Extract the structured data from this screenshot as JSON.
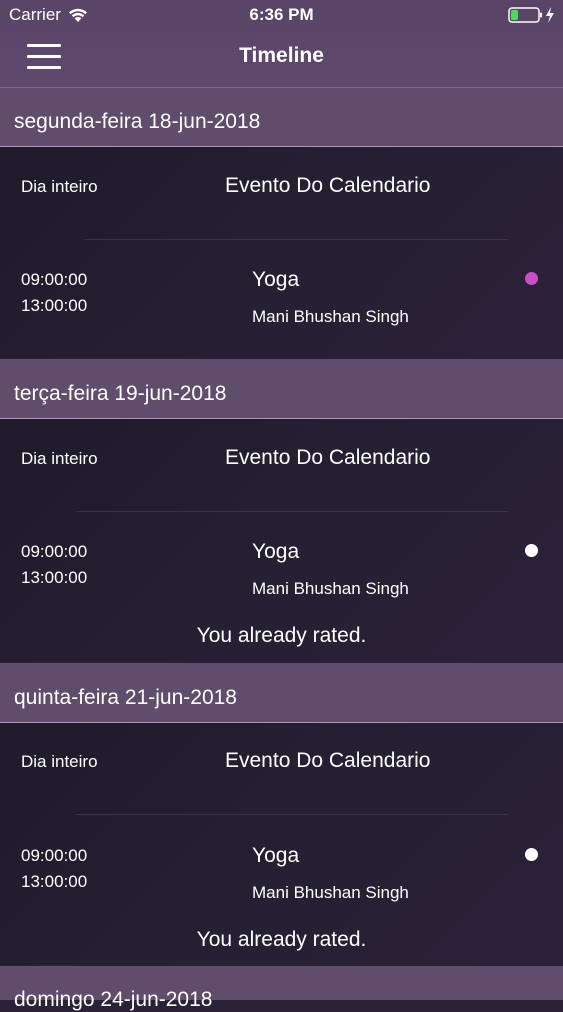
{
  "status_bar": {
    "carrier": "Carrier",
    "time": "6:36 PM"
  },
  "nav": {
    "title": "Timeline"
  },
  "colors": {
    "header_bg": "#5f4d6b",
    "card_bg": "#211d2d",
    "dot_pending": "#c94fc6",
    "dot_rated": "#ffffff"
  },
  "days": [
    {
      "date": "segunda-feira 18-jun-2018",
      "all_day": "Dia inteiro",
      "calendar_event": "Evento Do Calendario",
      "start": "09:00:00",
      "end": "13:00:00",
      "event_title": "Yoga",
      "person": "Mani Bhushan Singh",
      "dot": "pending-dot"
    },
    {
      "date": "terça-feira 19-jun-2018",
      "all_day": "Dia inteiro",
      "calendar_event": "Evento Do Calendario",
      "start": "09:00:00",
      "end": "13:00:00",
      "event_title": "Yoga",
      "person": "Mani Bhushan Singh",
      "dot": "rated-dot",
      "rated_text": "You already rated."
    },
    {
      "date": "quinta-feira 21-jun-2018",
      "all_day": "Dia inteiro",
      "calendar_event": "Evento Do Calendario",
      "start": "09:00:00",
      "end": "13:00:00",
      "event_title": "Yoga",
      "person": "Mani Bhushan Singh",
      "dot": "rated-dot",
      "rated_text": "You already rated."
    },
    {
      "date": "domingo 24-jun-2018"
    }
  ]
}
